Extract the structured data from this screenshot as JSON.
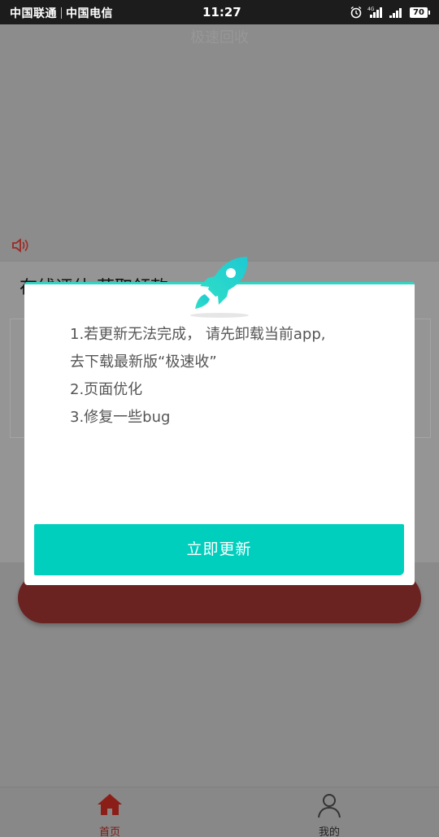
{
  "status_bar": {
    "carrier_1": "中国联通",
    "carrier_2": "中国电信",
    "time": "11:27",
    "battery": "70",
    "icons": [
      "alarm-icon",
      "signal-4g-icon",
      "signal-icon",
      "battery-icon"
    ]
  },
  "app": {
    "title": "极速回收",
    "card_title": "在线评估  获取领款",
    "colors": {
      "brand_red": "#8b2a25",
      "accent_teal": "#00cfbe"
    }
  },
  "dialog": {
    "icon": "rocket-icon",
    "notes": [
      "1.若更新无法完成， 请先卸载当前app,",
      "去下载最新版“极速收”",
      "2.页面优化",
      "3.修复一些bug"
    ],
    "update_button": "立即更新"
  },
  "tabbar": {
    "items": [
      {
        "label": "首页",
        "icon": "home-icon",
        "active": true
      },
      {
        "label": "我的",
        "icon": "user-icon",
        "active": false
      }
    ]
  }
}
